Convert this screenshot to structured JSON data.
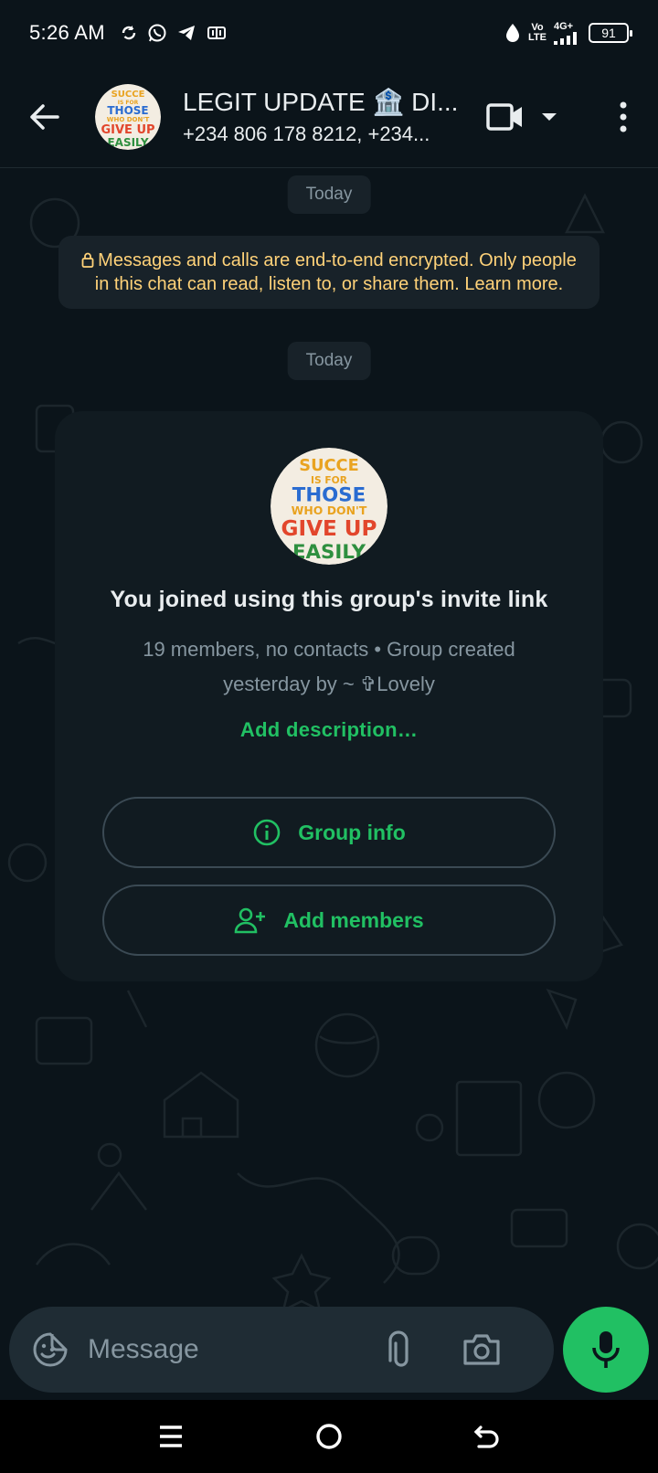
{
  "status_bar": {
    "time": "5:26 AM",
    "network_top": "Vo",
    "network_bottom": "LTE",
    "network_type": "4G+",
    "battery": "91"
  },
  "header": {
    "title": "LEGIT UPDATE 🏦 DI...",
    "subtitle": "+234 806 178 8212, +234..."
  },
  "chat": {
    "date_chip_1": "Today",
    "encryption_notice": "Messages and calls are end-to-end encrypted. Only people in this chat can read, listen to, or share them. Learn more.",
    "date_chip_2": "Today"
  },
  "join_card": {
    "avatar_text_lines": [
      "SUCCESS",
      "IS FOR",
      "THOSE",
      "WHO DON'T",
      "GIVE UP",
      "EASILY"
    ],
    "title": "You joined using this group's invite link",
    "info": "19 members, no contacts • Group created yesterday by ~ ✞Lovely",
    "add_description": "Add description…",
    "group_info_label": "Group info",
    "add_members_label": "Add members"
  },
  "composer": {
    "placeholder": "Message"
  },
  "colors": {
    "background": "#0b141a",
    "accent_green": "#21c063",
    "notice_yellow": "#ffd279",
    "card_bg": "#111b21"
  },
  "icons": [
    "back-arrow-icon",
    "video-call-icon",
    "dropdown-icon",
    "more-options-icon",
    "lock-icon",
    "info-icon",
    "add-person-icon",
    "sticker-icon",
    "attach-icon",
    "camera-icon",
    "mic-icon"
  ]
}
